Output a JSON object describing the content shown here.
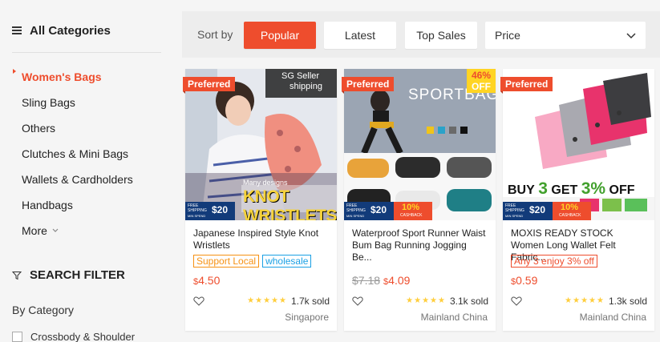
{
  "sidebar": {
    "all_categories": "All Categories",
    "categories": [
      {
        "label": "Women's Bags",
        "active": true
      },
      {
        "label": "Sling Bags"
      },
      {
        "label": "Others"
      },
      {
        "label": "Clutches & Mini Bags"
      },
      {
        "label": "Wallets & Cardholders"
      },
      {
        "label": "Handbags"
      }
    ],
    "more": "More",
    "search_filter": "SEARCH FILTER",
    "by_category": "By Category",
    "filter_option": "Crossbody & Shoulder"
  },
  "sortbar": {
    "label": "Sort by",
    "popular": "Popular",
    "latest": "Latest",
    "top_sales": "Top Sales",
    "price": "Price"
  },
  "colors": {
    "accent": "#ee4d2d",
    "star": "#ffce3d"
  },
  "products": [
    {
      "badge": "Preferred",
      "image_text_1": "SG Seller",
      "image_text_2": "shipping",
      "image_text_3": "Many designs",
      "image_text_4": "KNOT WRISTLETS",
      "free_shipping": "FREE SHIPPING",
      "free_amount": "$20",
      "free_note": "MIN SPEND",
      "name": "Japanese Inspired Style Knot Wristlets",
      "tags": [
        "Support Local",
        "wholesale"
      ],
      "currency": "$",
      "price": "4.50",
      "rating": 5,
      "sold": "1.7k sold",
      "location": "Singapore"
    },
    {
      "badge": "Preferred",
      "discount_pct": "46%",
      "discount_off": "OFF",
      "image_text_1": "SPORTBAG",
      "free_shipping": "FREE SHIPPING",
      "free_amount": "$20",
      "free_note": "MIN SPEND",
      "cashback": "10%",
      "cashback_label": "CASHBACK",
      "name": "Waterproof Sport Runner Waist Bum Bag Running Jogging Be...",
      "old_currency": "$",
      "old_price": "7.18",
      "currency": "$",
      "price": "4.09",
      "rating": 5,
      "sold": "3.1k sold",
      "location": "Mainland China"
    },
    {
      "badge": "Preferred",
      "image_text_1": "BUY",
      "image_text_2": "3",
      "image_text_3": "GET",
      "image_text_4": "3%",
      "image_text_5": "OFF",
      "free_shipping": "FREE SHIPPING",
      "free_amount": "$20",
      "free_note": "MIN SPEND",
      "cashback": "10%",
      "cashback_label": "CASHBACK",
      "name": "MOXIS READY STOCK Women Long Wallet Felt Fabric...",
      "tags": [
        "Any 3 enjoy 3% off"
      ],
      "currency": "$",
      "price": "0.59",
      "rating": 5,
      "sold": "1.3k sold",
      "location": "Mainland China"
    }
  ]
}
